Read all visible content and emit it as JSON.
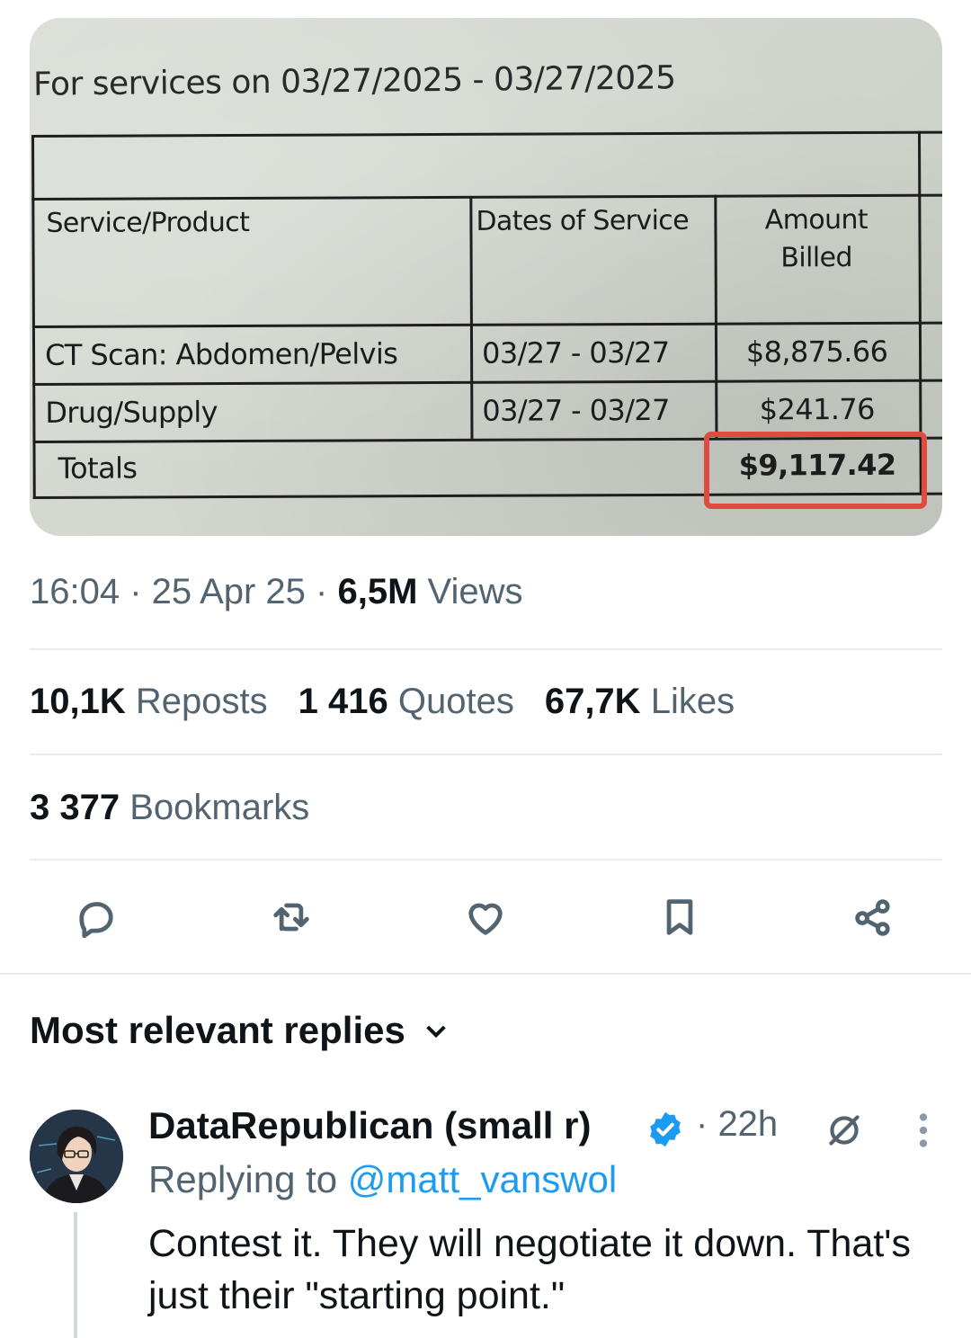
{
  "bill": {
    "service_dates_line": "For services on 03/27/2025 - 03/27/2025",
    "headers": {
      "service": "Service/Product",
      "dates": "Dates of Service",
      "amount_line1": "Amount",
      "amount_line2": "Billed"
    },
    "rows": [
      {
        "service": "CT Scan: Abdomen/Pelvis",
        "dates": "03/27 - 03/27",
        "amount": "$8,875.66"
      },
      {
        "service": "Drug/Supply",
        "dates": "03/27 - 03/27",
        "amount": "$241.76"
      }
    ],
    "totals_label": "Totals",
    "totals_amount": "$9,117.42",
    "highlight_color": "#e04a3f"
  },
  "meta": {
    "time": "16:04",
    "date": "25 Apr 25",
    "views_count": "6,5M",
    "views_label": "Views"
  },
  "stats": {
    "reposts_count": "10,1K",
    "reposts_label": "Reposts",
    "quotes_count": "1 416",
    "quotes_label": "Quotes",
    "likes_count": "67,7K",
    "likes_label": "Likes",
    "bookmarks_count": "3 377",
    "bookmarks_label": "Bookmarks"
  },
  "actions": [
    "reply-icon",
    "repost-icon",
    "like-icon",
    "bookmark-icon",
    "share-icon"
  ],
  "replies": {
    "sort_label": "Most relevant replies",
    "items": [
      {
        "name": "DataRepublican (small r)",
        "verified": true,
        "time": "22h",
        "replying_prefix": "Replying to",
        "replying_handle": "@matt_vanswol",
        "text": "Contest it. They will negotiate it down. That's just their \"starting point.\""
      }
    ]
  },
  "colors": {
    "text_primary": "#0f1419",
    "text_secondary": "#536471",
    "accent": "#1d9bf0",
    "divider": "#e6ecf0"
  }
}
